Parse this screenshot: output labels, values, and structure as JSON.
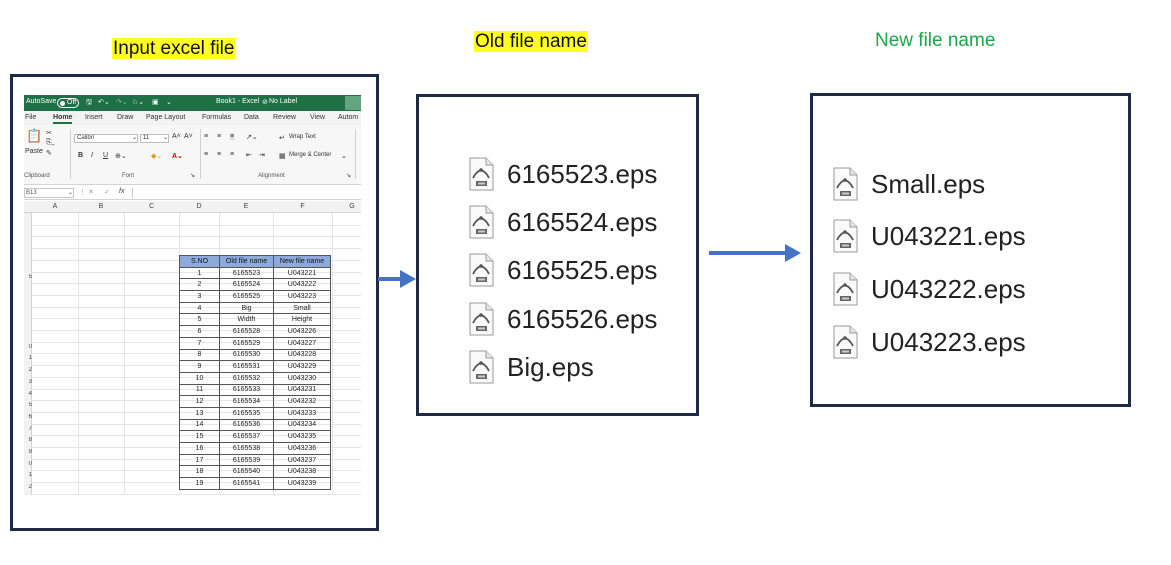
{
  "headings": {
    "input": "Input excel file",
    "old": "Old file name",
    "new": "New file name"
  },
  "colors": {
    "highlight": "#ffff22",
    "new_heading": "#1aa64a",
    "frame_border": "#1f2a44",
    "arrow": "#4472c4",
    "excel_green": "#1e7145",
    "table_header": "#8eaadb"
  },
  "excel": {
    "autosave_label": "AutoSave",
    "autosave_state": "Off",
    "title": "Book1 - Excel",
    "label_status": "No Label",
    "menu": [
      "File",
      "Home",
      "Insert",
      "Draw",
      "Page Layout",
      "Formulas",
      "Data",
      "Review",
      "View",
      "Autom"
    ],
    "ribbon": {
      "paste_label": "Paste",
      "font_name": "Calibri",
      "font_size": "11",
      "bold": "B",
      "italic": "I",
      "underline": "U",
      "grow_font": "A˄",
      "shrink_font": "A˅",
      "wrap_text": "Wrap Text",
      "merge_center": "Merge & Center",
      "group_clipboard": "Clipboard",
      "group_font": "Font",
      "group_alignment": "Alignment"
    },
    "name_box": "B13",
    "fx": "fx",
    "columns": [
      "A",
      "B",
      "C",
      "D",
      "E",
      "F",
      "G"
    ],
    "rows": [
      "",
      "",
      "",
      "",
      "",
      "5",
      "",
      "",
      "",
      "",
      "",
      "0",
      "1",
      "2",
      "3",
      "4",
      "5",
      "6",
      "7",
      "8",
      "9",
      "0",
      "1",
      "2",
      "3"
    ],
    "table_headers": [
      "S.NO",
      "Old file name",
      "New file name"
    ],
    "table_rows": [
      [
        "1",
        "6165523",
        "U043221"
      ],
      [
        "2",
        "6165524",
        "U043222"
      ],
      [
        "3",
        "6165525",
        "U043223"
      ],
      [
        "4",
        "Big",
        "Small"
      ],
      [
        "5",
        "Width",
        "Height"
      ],
      [
        "6",
        "6165528",
        "U043226"
      ],
      [
        "7",
        "6165529",
        "U043227"
      ],
      [
        "8",
        "6165530",
        "U043228"
      ],
      [
        "9",
        "6165531",
        "U043229"
      ],
      [
        "10",
        "6165532",
        "U043230"
      ],
      [
        "11",
        "6165533",
        "U043231"
      ],
      [
        "12",
        "6165534",
        "U043232"
      ],
      [
        "13",
        "6165535",
        "U043233"
      ],
      [
        "14",
        "6165536",
        "U043234"
      ],
      [
        "15",
        "6165537",
        "U043235"
      ],
      [
        "16",
        "6165538",
        "U043236"
      ],
      [
        "17",
        "6165539",
        "U043237"
      ],
      [
        "18",
        "6165540",
        "U043238"
      ],
      [
        "19",
        "6165541",
        "U043239"
      ]
    ]
  },
  "old_files": [
    "6165523.eps",
    "6165524.eps",
    "6165525.eps",
    "6165526.eps",
    "Big.eps"
  ],
  "new_files": [
    "Small.eps",
    "U043221.eps",
    "U043222.eps",
    "U043223.eps"
  ],
  "icon": "eps-file-icon"
}
